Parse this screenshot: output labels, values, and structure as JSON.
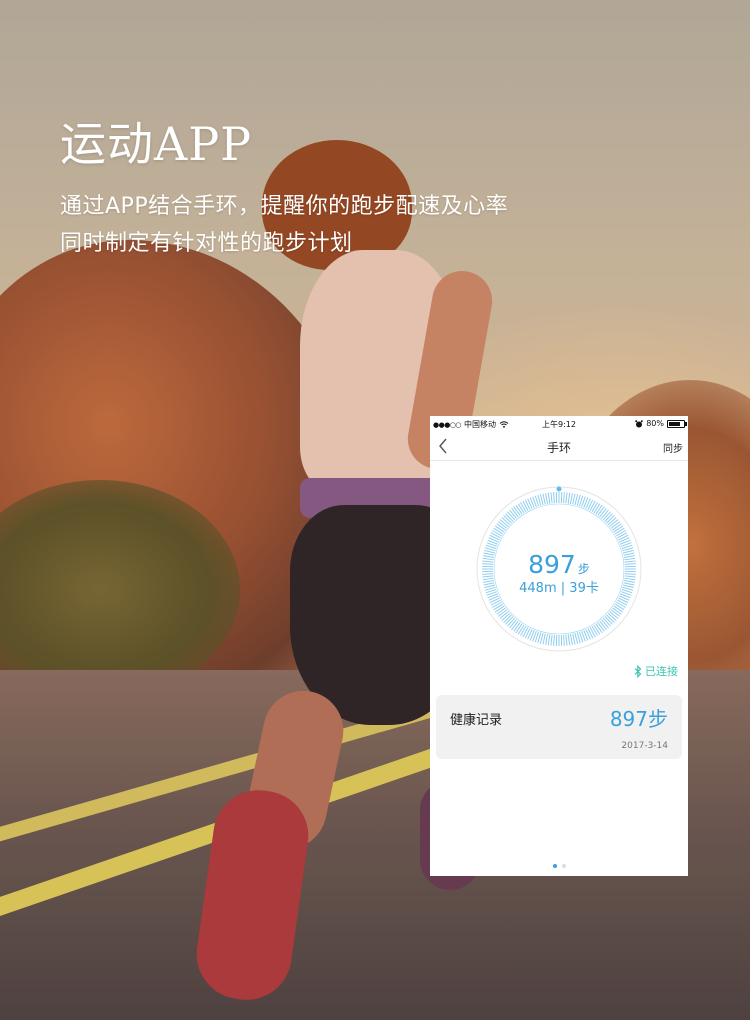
{
  "headline": "运动APP",
  "subtitle_line1": "通过APP结合手环，提醒你的跑步配速及心率",
  "subtitle_line2": "同时制定有针对性的跑步计划",
  "phone": {
    "status": {
      "carrier": "中国移动",
      "time": "上午9:12",
      "battery": "80%"
    },
    "nav": {
      "title": "手环",
      "sync_label": "同步"
    },
    "ring": {
      "steps": "897",
      "steps_unit": "步",
      "distance": "448m",
      "separator": "|",
      "calories": "39卡",
      "progress": 1.0
    },
    "connection_status": "已连接",
    "health_card": {
      "label": "健康记录",
      "steps": "897步",
      "date": "2017-3-14"
    },
    "pager": {
      "total": 2,
      "active": 1
    }
  },
  "colors": {
    "accent_blue": "#3aa0dc",
    "connected_teal": "#3cc4b0",
    "headline_text": "#ffffff"
  },
  "icons": [
    "signal-dots-icon",
    "wifi-icon",
    "alarm-icon",
    "battery-icon",
    "back-chevron-icon",
    "bluetooth-icon"
  ]
}
